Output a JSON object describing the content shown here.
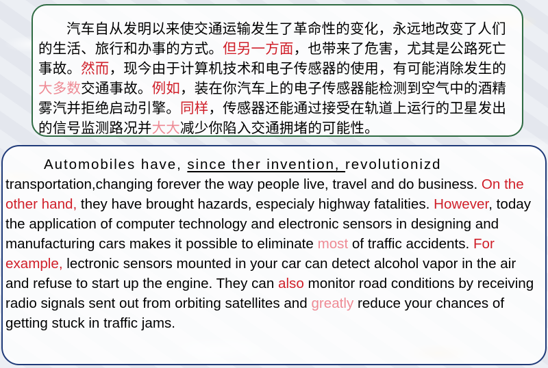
{
  "chinese": {
    "s1": "汽车自从发明以来使交通运输发生了革命性的变化，永远地改变了人们的生活、旅行和办事的方式。",
    "t1": "但另一方面",
    "s2": "，也带来了危害，尤其是公路死亡事故。",
    "t2": "然而",
    "s3": "，现今由于计算机技术和电子传感器的使用，有可能消除发生的",
    "t3": "大多数",
    "s4": "交通事故。",
    "t4": "例如",
    "s5": "，装在你汽车上的电子传感器能检测到空气中的酒精雾汽并拒绝启动引擎。",
    "t5": "同样",
    "s6": "，传感器还能通过接受在轨道上运行的卫星发出的信号监测路况并",
    "t6": "大大",
    "s7": "减少你陷入交通拥堵的可能性。"
  },
  "english": {
    "line1a": "Automobiles have, ",
    "line1u": "since ther invention, ",
    "line1b": "revolutionizd",
    "s1": "transportation,changing forever the way people live, travel and do business. ",
    "t1": "On the other hand,",
    "s2": " they have brought hazards, especialy highway fatalities. ",
    "t2": "However",
    "s3": ", today the application of computer technology and electronic sensors in designing and manufacturing cars makes it possible to eliminate ",
    "t3": "most",
    "s4": " of traffic accidents. ",
    "t4": "For example,",
    "s5": " lectronic sensors mounted in your car can detect alcohol vapor in the air and refuse to start up the engine. They can ",
    "t5": "also",
    "s6": " monitor road conditions by receiving radio signals sent out from orbiting satellites and ",
    "t6": "greatly",
    "s7": " reduce your chances of getting stuck in traffic jams."
  },
  "colors": {
    "highlight_red": "#d0202a",
    "highlight_pink": "#ee8a94",
    "cn_border": "#2f6b43",
    "en_border": "#1f3a78"
  }
}
